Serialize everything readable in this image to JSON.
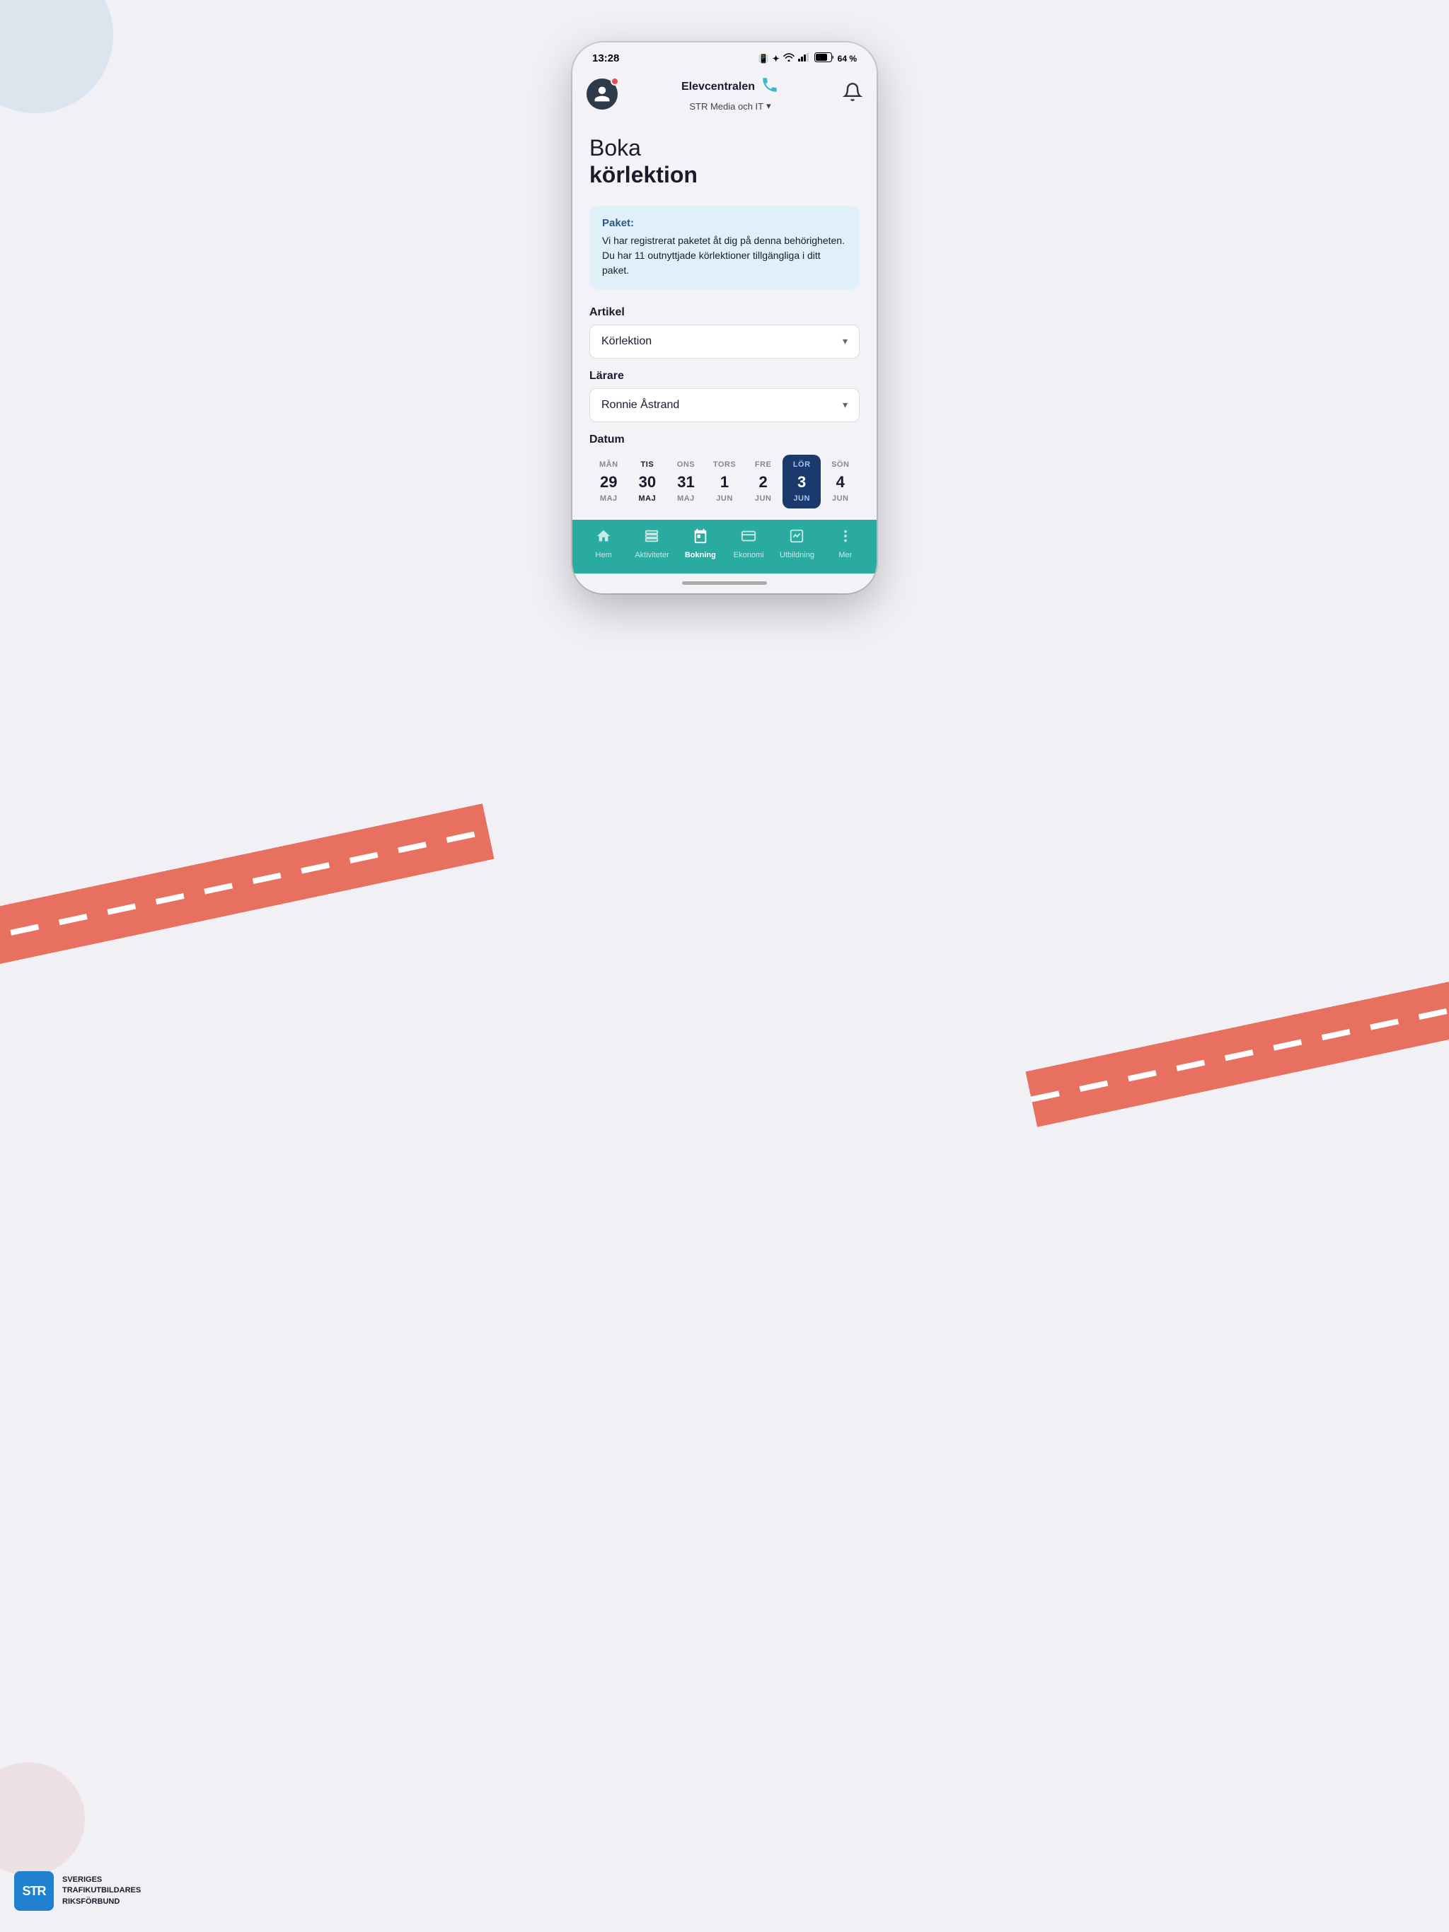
{
  "statusBar": {
    "time": "13:28",
    "battery": "64 %",
    "icons": "📳 ✦ ◈ .all .all 🔋"
  },
  "topNav": {
    "brandName": "Elevcentralen",
    "subtitle": "STR Media och IT",
    "subtitleChevron": "▾"
  },
  "page": {
    "titleLight": "Boka",
    "titleBold": "körlektion"
  },
  "infoBox": {
    "title": "Paket:",
    "text": "Vi har registrerat paketet åt dig på denna behörigheten. Du har 11 outnyttjade körlektioner tillgängliga i ditt paket."
  },
  "form": {
    "artikelLabel": "Artikel",
    "artikelValue": "Körlektion",
    "larareLabel": "Lärare",
    "larareValue": "Ronnie Åstrand",
    "datumLabel": "Datum"
  },
  "calendar": {
    "days": [
      {
        "name": "MÅN",
        "num": "29",
        "month": "MAJ",
        "selected": false,
        "today": false
      },
      {
        "name": "TIS",
        "num": "30",
        "month": "MAJ",
        "selected": false,
        "today": true
      },
      {
        "name": "ONS",
        "num": "31",
        "month": "MAJ",
        "selected": false,
        "today": false
      },
      {
        "name": "TORS",
        "num": "1",
        "month": "JUN",
        "selected": false,
        "today": false
      },
      {
        "name": "FRE",
        "num": "2",
        "month": "JUN",
        "selected": false,
        "today": false
      },
      {
        "name": "LÖR",
        "num": "3",
        "month": "JUN",
        "selected": true,
        "today": false
      },
      {
        "name": "SÖN",
        "num": "4",
        "month": "JUN",
        "selected": false,
        "today": false
      }
    ]
  },
  "bottomNav": {
    "items": [
      {
        "label": "Hem",
        "icon": "home",
        "active": false
      },
      {
        "label": "Aktiviteter",
        "icon": "list",
        "active": false
      },
      {
        "label": "Bokning",
        "icon": "calendar",
        "active": true
      },
      {
        "label": "Ekonomi",
        "icon": "card",
        "active": false
      },
      {
        "label": "Utbildning",
        "icon": "chart",
        "active": false
      },
      {
        "label": "Mer",
        "icon": "dots",
        "active": false
      }
    ]
  },
  "strLogo": {
    "abbrev": "STR",
    "line1": "SVERIGES",
    "line2": "TRAFIKUTBILDARES",
    "line3": "RIKSFÖRBUND"
  }
}
